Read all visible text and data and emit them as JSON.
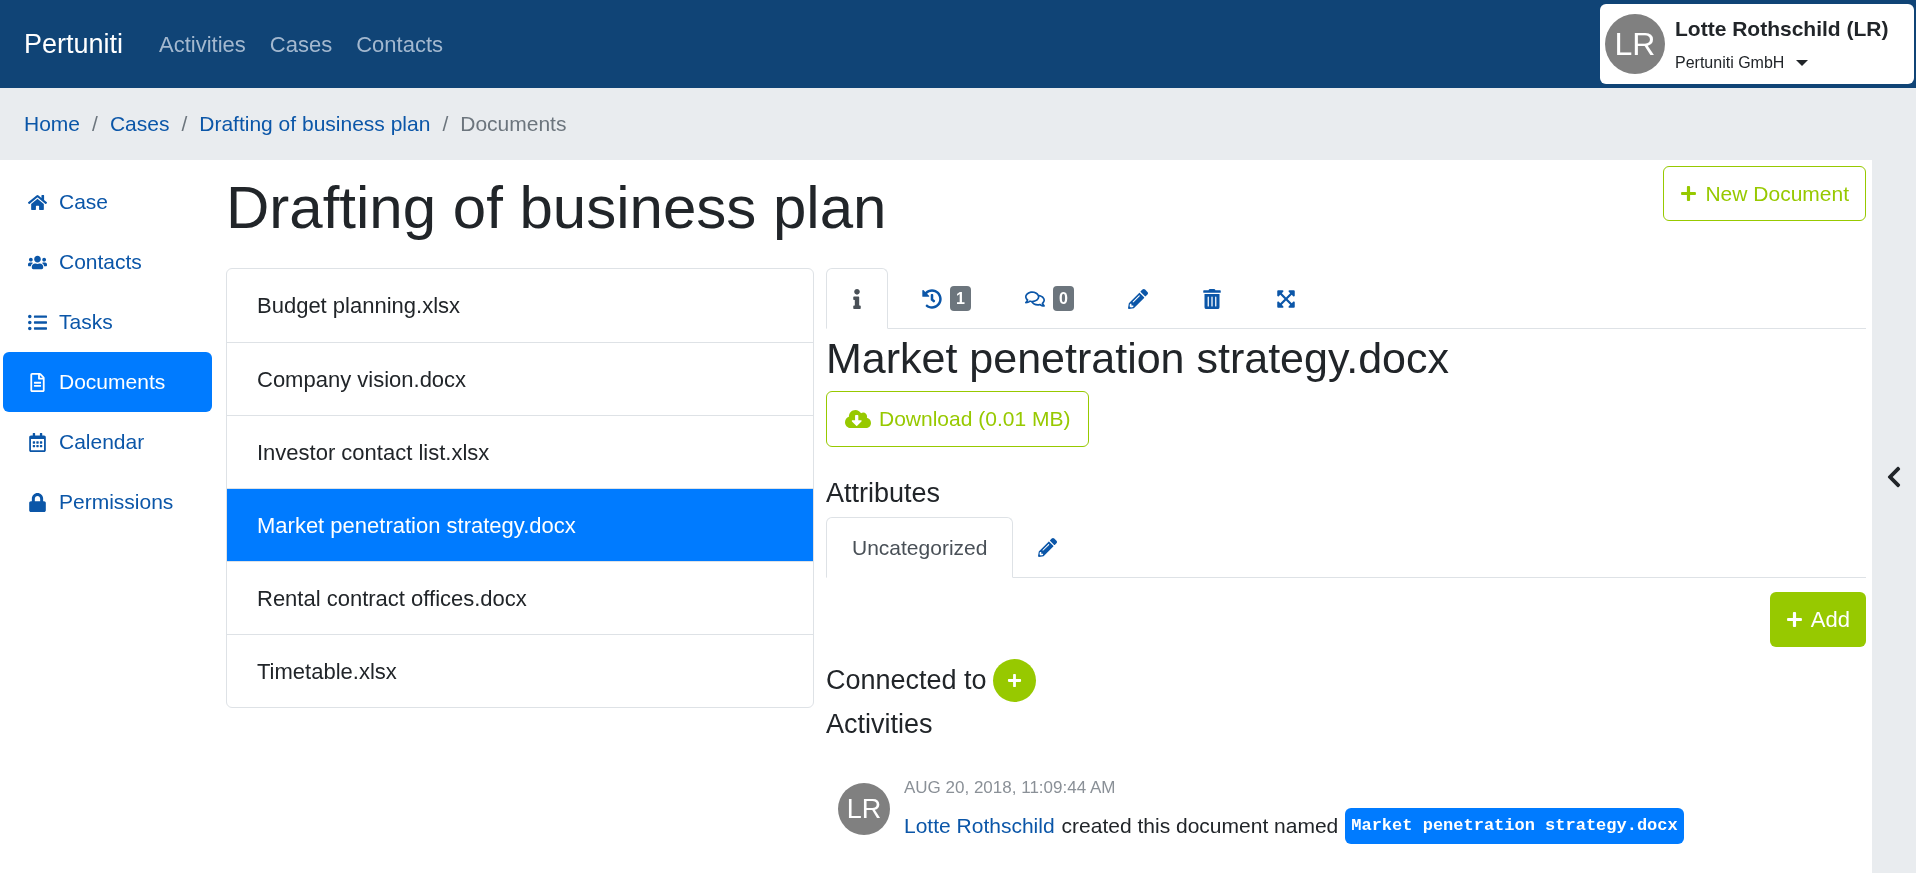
{
  "navbar": {
    "brand": "Pertuniti",
    "links": [
      "Activities",
      "Cases",
      "Contacts"
    ],
    "user": {
      "initials": "LR",
      "name": "Lotte Rothschild (LR)",
      "company": "Pertuniti GmbH"
    }
  },
  "breadcrumb_separator": "/",
  "breadcrumb": [
    {
      "label": "Home",
      "current": false
    },
    {
      "label": "Cases",
      "current": false
    },
    {
      "label": "Drafting of business plan",
      "current": false
    },
    {
      "label": "Documents",
      "current": true
    }
  ],
  "sidebar": {
    "items": [
      {
        "label": "Case",
        "selected": false
      },
      {
        "label": "Contacts",
        "selected": false
      },
      {
        "label": "Tasks",
        "selected": false
      },
      {
        "label": "Documents",
        "selected": true
      },
      {
        "label": "Calendar",
        "selected": false
      },
      {
        "label": "Permissions",
        "selected": false
      }
    ]
  },
  "page": {
    "title": "Drafting of business plan",
    "new_button": "New Document"
  },
  "documents": [
    {
      "name": "Budget planning.xlsx",
      "selected": false
    },
    {
      "name": "Company vision.docx",
      "selected": false
    },
    {
      "name": "Investor contact list.xlsx",
      "selected": false
    },
    {
      "name": "Market penetration strategy.docx",
      "selected": true
    },
    {
      "name": "Rental contract offices.docx",
      "selected": false
    },
    {
      "name": "Timetable.xlsx",
      "selected": false
    }
  ],
  "detail": {
    "tabs": [
      {
        "kind": "info",
        "selected": true
      },
      {
        "kind": "history",
        "badge": "1",
        "selected": false
      },
      {
        "kind": "comments",
        "badge": "0",
        "selected": false
      },
      {
        "kind": "edit",
        "selected": false
      },
      {
        "kind": "delete",
        "selected": false
      },
      {
        "kind": "expand",
        "selected": false
      }
    ],
    "title": "Market penetration strategy.docx",
    "download": "Download (0.01 MB)",
    "attributes_heading": "Attributes",
    "attribute_tabs": [
      {
        "label": "Uncategorized",
        "selected": true
      }
    ],
    "add_button": "Add",
    "connected_to": "Connected to",
    "activities_heading": "Activities",
    "activities": [
      {
        "initials": "LR",
        "time": "AUG 20, 2018, 11:09:44 AM",
        "user": "Lotte Rothschild",
        "text": "created this document named",
        "target": "Market penetration strategy.docx"
      }
    ]
  }
}
